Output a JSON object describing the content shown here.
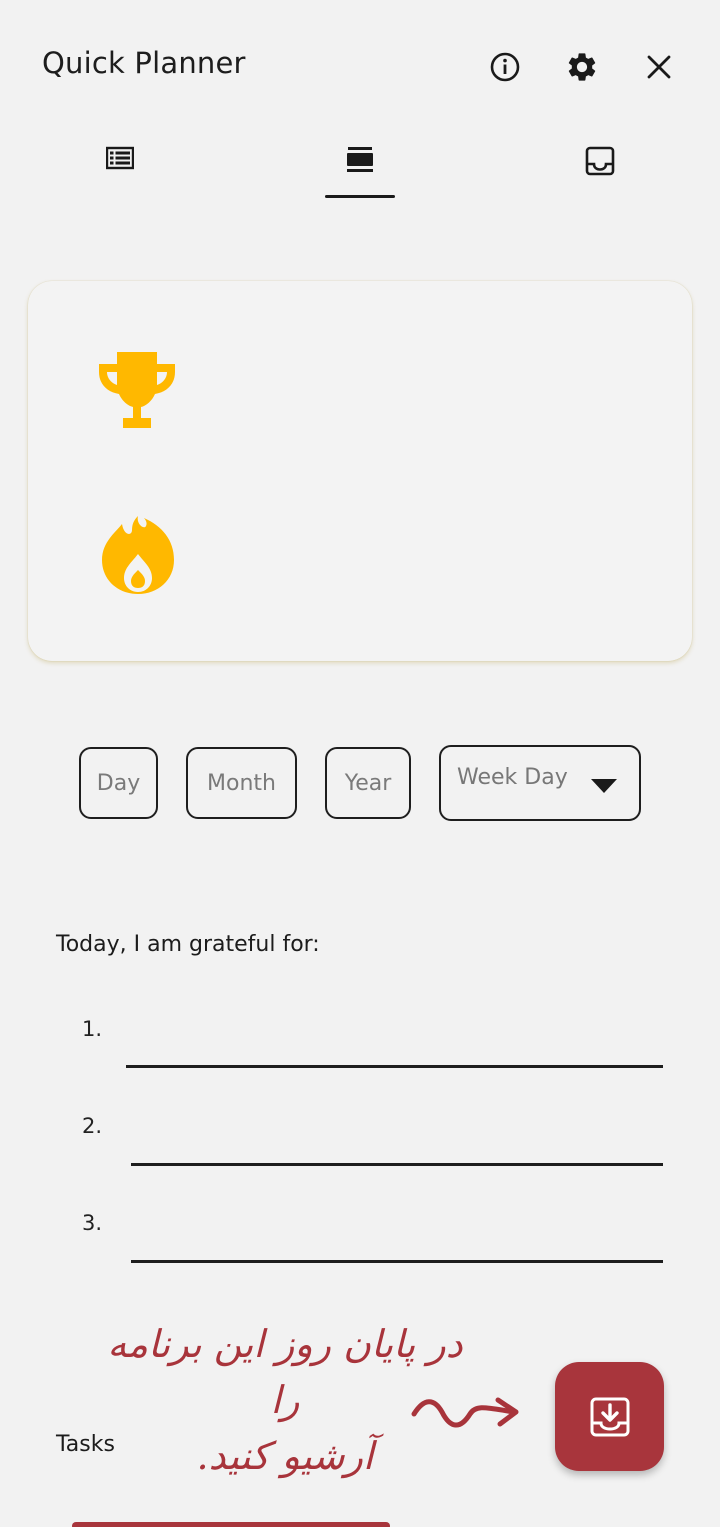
{
  "header": {
    "title": "Quick Planner",
    "icons": [
      "info-icon",
      "gear-icon",
      "close-icon"
    ]
  },
  "tabs": [
    {
      "icon": "list-icon",
      "active": false
    },
    {
      "icon": "card-view-icon",
      "active": true
    },
    {
      "icon": "inbox-icon",
      "active": false
    }
  ],
  "stats_card": {
    "icons": [
      "trophy-icon",
      "flame-icon"
    ],
    "accent_color": "#FFB800"
  },
  "date": {
    "day_placeholder": "Day",
    "month_placeholder": "Month",
    "year_placeholder": "Year",
    "weekday_label": "Week Day"
  },
  "gratitude": {
    "heading": "Today, I am grateful for:",
    "items": [
      {
        "number": "1.",
        "value": ""
      },
      {
        "number": "2.",
        "value": ""
      },
      {
        "number": "3.",
        "value": ""
      }
    ]
  },
  "note": {
    "line1": "در پایان روز این برنامه را",
    "line2": "آرشیو کنید.",
    "color": "#A8353C"
  },
  "tasks": {
    "heading": "Tasks"
  },
  "fab": {
    "icon": "archive-download-icon",
    "color": "#A8353C"
  }
}
